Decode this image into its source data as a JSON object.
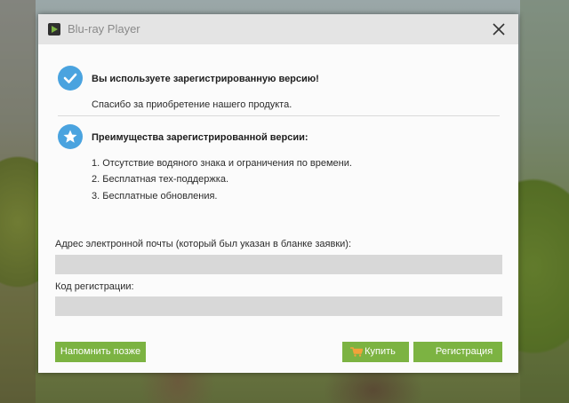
{
  "window": {
    "title": "Blu-ray Player"
  },
  "registered": {
    "heading": "Вы используете зарегистрированную версию!",
    "thanks": "Спасибо за приобретение нашего продукта."
  },
  "advantages": {
    "heading": "Преимущества зарегистрированной версии:",
    "items": [
      "1. Отсутствие водяного знака и ограничения по времени.",
      "2. Бесплатная тех-поддержка.",
      "3. Бесплатные обновления."
    ]
  },
  "form": {
    "email_label": "Адрес электронной почты (который был указан в бланке заявки):",
    "email_value": "",
    "code_label": "Код регистрации:",
    "code_value": ""
  },
  "buttons": {
    "remind_later": "Напомнить позже",
    "buy": "Купить",
    "register": "Регистрация"
  },
  "colors": {
    "accent_button": "#7cb342",
    "icon_blue": "#4aa3df",
    "cart_icon": "#f2a23a"
  },
  "icons": [
    "app-logo-icon",
    "close-icon",
    "checkmark-icon",
    "star-icon",
    "cart-icon"
  ]
}
